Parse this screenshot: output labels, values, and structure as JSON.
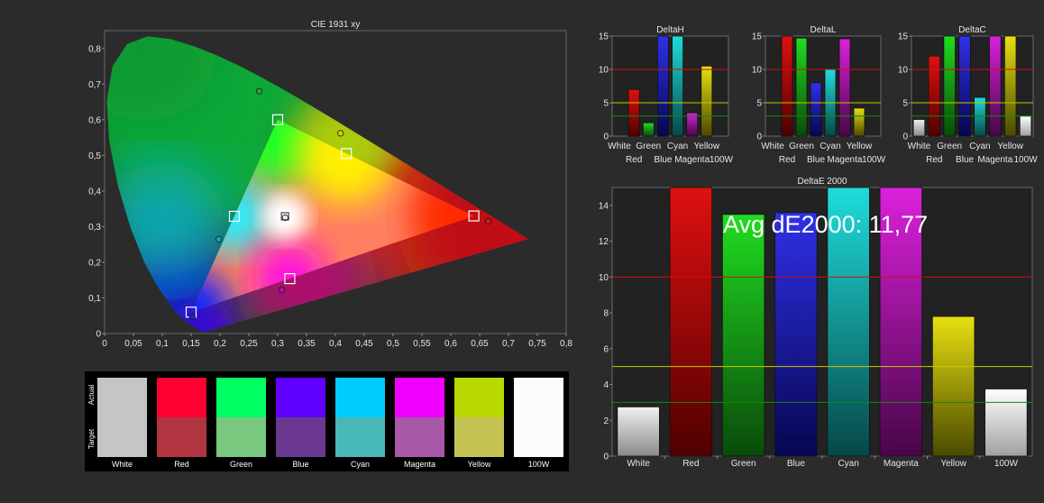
{
  "chart_data": [
    {
      "id": "cie",
      "type": "scatter",
      "title": "CIE 1931 xy",
      "xlim": [
        0,
        0.8
      ],
      "ylim": [
        0,
        0.85
      ],
      "x_ticks": [
        "0",
        "0,05",
        "0,1",
        "0,15",
        "0,2",
        "0,25",
        "0,3",
        "0,35",
        "0,4",
        "0,45",
        "0,5",
        "0,55",
        "0,6",
        "0,65",
        "0,7",
        "0,75",
        "0,8"
      ],
      "y_ticks": [
        "0",
        "0,1",
        "0,2",
        "0,3",
        "0,4",
        "0,5",
        "0,6",
        "0,7",
        "0,8"
      ],
      "targets": [
        {
          "name": "Red",
          "x": 0.64,
          "y": 0.33
        },
        {
          "name": "Green",
          "x": 0.3,
          "y": 0.6
        },
        {
          "name": "Blue",
          "x": 0.15,
          "y": 0.06
        },
        {
          "name": "Cyan",
          "x": 0.225,
          "y": 0.329
        },
        {
          "name": "Magenta",
          "x": 0.321,
          "y": 0.154
        },
        {
          "name": "Yellow",
          "x": 0.419,
          "y": 0.505
        },
        {
          "name": "White",
          "x": 0.3127,
          "y": 0.329
        }
      ],
      "measured": [
        {
          "name": "Red",
          "x": 0.665,
          "y": 0.315,
          "color": "#d01818"
        },
        {
          "name": "Green",
          "x": 0.268,
          "y": 0.68,
          "color": "#22aa22"
        },
        {
          "name": "Blue",
          "x": 0.152,
          "y": 0.047,
          "color": "#2222cc"
        },
        {
          "name": "Cyan",
          "x": 0.198,
          "y": 0.265,
          "color": "#10a8a8"
        },
        {
          "name": "Magenta",
          "x": 0.307,
          "y": 0.122,
          "color": "#b010b0"
        },
        {
          "name": "Yellow",
          "x": 0.409,
          "y": 0.562,
          "color": "#d8c800"
        },
        {
          "name": "White",
          "x": 0.313,
          "y": 0.325,
          "color": "#e8e8e8"
        }
      ]
    },
    {
      "id": "deltaH",
      "type": "bar",
      "title": "DeltaH",
      "ylim": [
        0,
        15
      ],
      "y_ticks": [
        "0",
        "5",
        "10",
        "15"
      ],
      "categories_top": [
        "White",
        "Green",
        "Cyan",
        "Yellow"
      ],
      "categories_bottom": [
        "Red",
        "Blue",
        "Magenta",
        "100W"
      ],
      "values": [
        0,
        7,
        2,
        15,
        15,
        3.5,
        10.5,
        0
      ]
    },
    {
      "id": "deltaL",
      "type": "bar",
      "title": "DeltaL",
      "ylim": [
        0,
        15
      ],
      "y_ticks": [
        "0",
        "5",
        "10",
        "15"
      ],
      "categories_top": [
        "White",
        "Green",
        "Cyan",
        "Yellow"
      ],
      "categories_bottom": [
        "Red",
        "Blue",
        "Magenta",
        "100W"
      ],
      "values": [
        0,
        15,
        14.7,
        8,
        10,
        14.6,
        4.2,
        0
      ]
    },
    {
      "id": "deltaC",
      "type": "bar",
      "title": "DeltaC",
      "ylim": [
        0,
        15
      ],
      "y_ticks": [
        "0",
        "5",
        "10",
        "15"
      ],
      "categories_top": [
        "White",
        "Green",
        "Cyan",
        "Yellow"
      ],
      "categories_bottom": [
        "Red",
        "Blue",
        "Magenta",
        "100W"
      ],
      "values": [
        2.5,
        12,
        15,
        15,
        5.8,
        15,
        15,
        3
      ]
    },
    {
      "id": "deltaE",
      "type": "bar",
      "title": "DeltaE 2000",
      "ylim": [
        0,
        15
      ],
      "y_ticks": [
        "0",
        "2",
        "4",
        "6",
        "8",
        "10",
        "12",
        "14"
      ],
      "categories": [
        "White",
        "Red",
        "Green",
        "Blue",
        "Cyan",
        "Magenta",
        "Yellow",
        "100W"
      ],
      "values": [
        2.75,
        15,
        13.5,
        13.6,
        15,
        15,
        7.8,
        3.75
      ],
      "annotation": "Avg dE2000: 11,77"
    }
  ],
  "reference_lines": [
    {
      "value": 10,
      "color": "#cc1010"
    },
    {
      "value": 5,
      "color": "#c8c800"
    },
    {
      "value": 3,
      "color": "#108a10"
    }
  ],
  "bar_colors": [
    [
      "#f0f0f0",
      "#8a8a8a"
    ],
    [
      "#e01010",
      "#500000"
    ],
    [
      "#20dd20",
      "#0a4a0a"
    ],
    [
      "#3030e8",
      "#060650"
    ],
    [
      "#20dcdc",
      "#064848"
    ],
    [
      "#dc20dc",
      "#480648"
    ],
    [
      "#e8e010",
      "#4a4a00"
    ],
    [
      "#ffffff",
      "#a0a0a0"
    ]
  ],
  "swatches": {
    "actual_label": "Actual",
    "target_label": "Target",
    "items": [
      {
        "name": "White",
        "actual": "#c5c5c5",
        "target": "#c5c5c5"
      },
      {
        "name": "Red",
        "actual": "#ff0030",
        "target": "#b03540"
      },
      {
        "name": "Green",
        "actual": "#00ff60",
        "target": "#78c880"
      },
      {
        "name": "Blue",
        "actual": "#6000ff",
        "target": "#6a3890"
      },
      {
        "name": "Cyan",
        "actual": "#00ccff",
        "target": "#48b8b8"
      },
      {
        "name": "Magenta",
        "actual": "#f000ff",
        "target": "#a858a8"
      },
      {
        "name": "Yellow",
        "actual": "#b8d800",
        "target": "#c4c455"
      },
      {
        "name": "100W",
        "actual": "#fcfcfe",
        "target": "#fcfcfe"
      }
    ]
  }
}
